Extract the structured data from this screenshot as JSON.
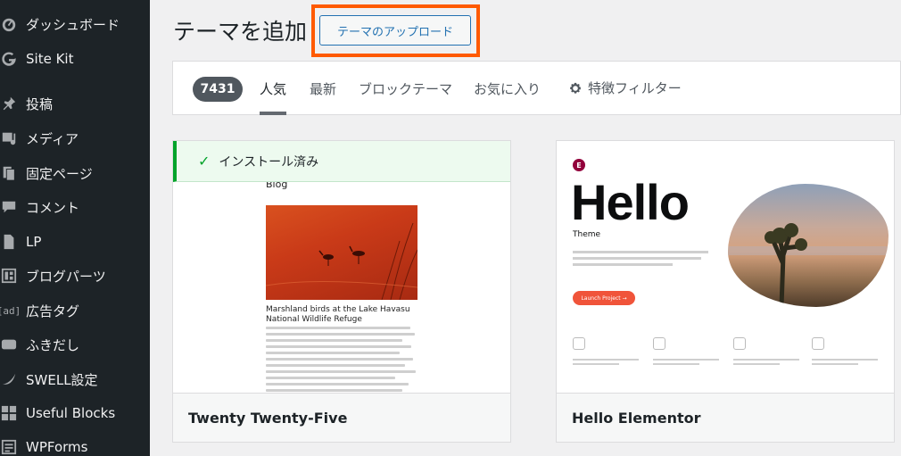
{
  "sidebar": {
    "items": [
      {
        "label": "ダッシュボード",
        "icon": "dashboard-icon"
      },
      {
        "label": "Site Kit",
        "icon": "google-g-icon"
      },
      {
        "label": "投稿",
        "icon": "pin-icon"
      },
      {
        "label": "メディア",
        "icon": "media-icon"
      },
      {
        "label": "固定ページ",
        "icon": "pages-icon"
      },
      {
        "label": "コメント",
        "icon": "comment-icon"
      },
      {
        "label": "LP",
        "icon": "document-icon"
      },
      {
        "label": "ブログパーツ",
        "icon": "layout-icon"
      },
      {
        "label": "広告タグ",
        "icon": "ad-tag-icon"
      },
      {
        "label": "ふきだし",
        "icon": "speech-bubble-icon"
      },
      {
        "label": "SWELL設定",
        "icon": "swell-icon"
      },
      {
        "label": "Useful Blocks",
        "icon": "grid-icon"
      },
      {
        "label": "WPForms",
        "icon": "form-icon"
      }
    ]
  },
  "header": {
    "title": "テーマを追加",
    "upload_label": "テーマのアップロード"
  },
  "filter": {
    "count": "7431",
    "tabs": [
      "人気",
      "最新",
      "ブロックテーマ",
      "お気に入り"
    ],
    "active_tab": "人気",
    "feature_filter_label": "特徴フィルター"
  },
  "themes": [
    {
      "name": "Twenty Twenty-Five",
      "installed": true,
      "installed_label": "インストール済み",
      "preview": {
        "heading": "Blog",
        "caption": "Marshland birds at the Lake Havasu National Wildlife Refuge"
      }
    },
    {
      "name": "Hello Elementor",
      "installed": false,
      "preview": {
        "logo": "E",
        "headline": "Hello",
        "subhead": "Theme",
        "button": "Launch Project →"
      }
    }
  ],
  "colors": {
    "sidebar_bg": "#1d2327",
    "accent": "#2271b1",
    "highlight": "#ff5a00",
    "installed_green": "#00a32a"
  }
}
